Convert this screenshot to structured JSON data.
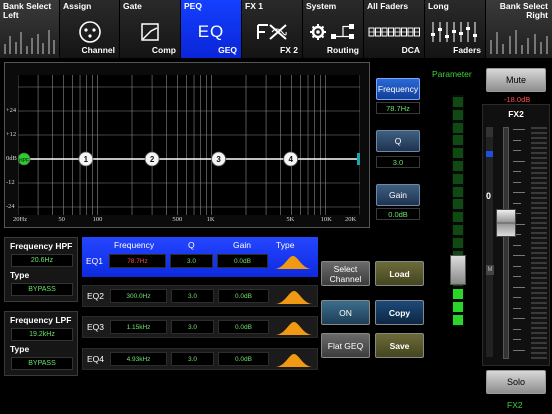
{
  "topbar": {
    "bank_left": "Bank Select\nLeft",
    "bank_right": "Bank Select\nRight",
    "tabs": [
      {
        "top": "Assign",
        "bottom": "Channel",
        "icon": "xlr-connector-icon"
      },
      {
        "top": "Gate",
        "bottom": "Comp",
        "icon": "compressor-curve-icon"
      },
      {
        "top": "PEQ",
        "bottom": "GEQ",
        "center": "EQ",
        "icon": "eq-icon"
      },
      {
        "top": "FX 1",
        "bottom": "FX 2",
        "icon": "fx-icon"
      },
      {
        "top": "System",
        "bottom": "Routing",
        "icon": "gear-routing-icon"
      },
      {
        "top": "All Faders",
        "bottom": "DCA",
        "icon": "faders-row-icon"
      },
      {
        "top": "Long",
        "bottom": "Faders",
        "icon": "long-faders-icon"
      }
    ]
  },
  "graph": {
    "y_labels": [
      "+24",
      "+12",
      "0dB",
      "-12",
      "-24"
    ],
    "x_labels": [
      "20Hz",
      "50",
      "100",
      "500",
      "1K",
      "5K",
      "10K",
      "20K"
    ],
    "points": [
      {
        "label": "HPF"
      },
      {
        "label": "1"
      },
      {
        "label": "2"
      },
      {
        "label": "3"
      },
      {
        "label": "4"
      }
    ]
  },
  "params": {
    "frequency_label": "Frequency",
    "frequency_value": "78.7Hz",
    "q_label": "Q",
    "q_value": "3.0",
    "gain_label": "Gain",
    "gain_value": "0.0dB"
  },
  "meter": {
    "title": "Parameter"
  },
  "hpf": {
    "title": "Frequency HPF",
    "value": "20.6Hz",
    "type_label": "Type",
    "type_value": "BYPASS"
  },
  "lpf": {
    "title": "Frequency LPF",
    "value": "19.2kHz",
    "type_label": "Type",
    "type_value": "BYPASS"
  },
  "eq_table": {
    "headers": {
      "frequency": "Frequency",
      "q": "Q",
      "gain": "Gain",
      "type": "Type"
    },
    "rows": [
      {
        "name": "EQ1",
        "freq": "78.7Hz",
        "q": "3.0",
        "gain": "0.0dB"
      },
      {
        "name": "EQ2",
        "freq": "300.0Hz",
        "q": "3.0",
        "gain": "0.0dB"
      },
      {
        "name": "EQ3",
        "freq": "1.15kHz",
        "q": "3.0",
        "gain": "0.0dB"
      },
      {
        "name": "EQ4",
        "freq": "4.93kHz",
        "q": "3.0",
        "gain": "0.0dB"
      }
    ]
  },
  "actions": {
    "select_channel": "Select\nChannel",
    "load": "Load",
    "on": "ON",
    "copy": "Copy",
    "flat_geq": "Flat GEQ",
    "save": "Save"
  },
  "strip": {
    "mute": "Mute",
    "level": "-18.0dB",
    "name": "FX2",
    "scale_zero": "0",
    "fader_marker": "M",
    "solo": "Solo",
    "footer": "FX2",
    "fader_level": 0.6
  },
  "colors": {
    "accent": "#0a25d8",
    "value_green": "#6be36b",
    "eq1_value_red": "#ff4a4a",
    "shape_orange": "#f09a14"
  }
}
